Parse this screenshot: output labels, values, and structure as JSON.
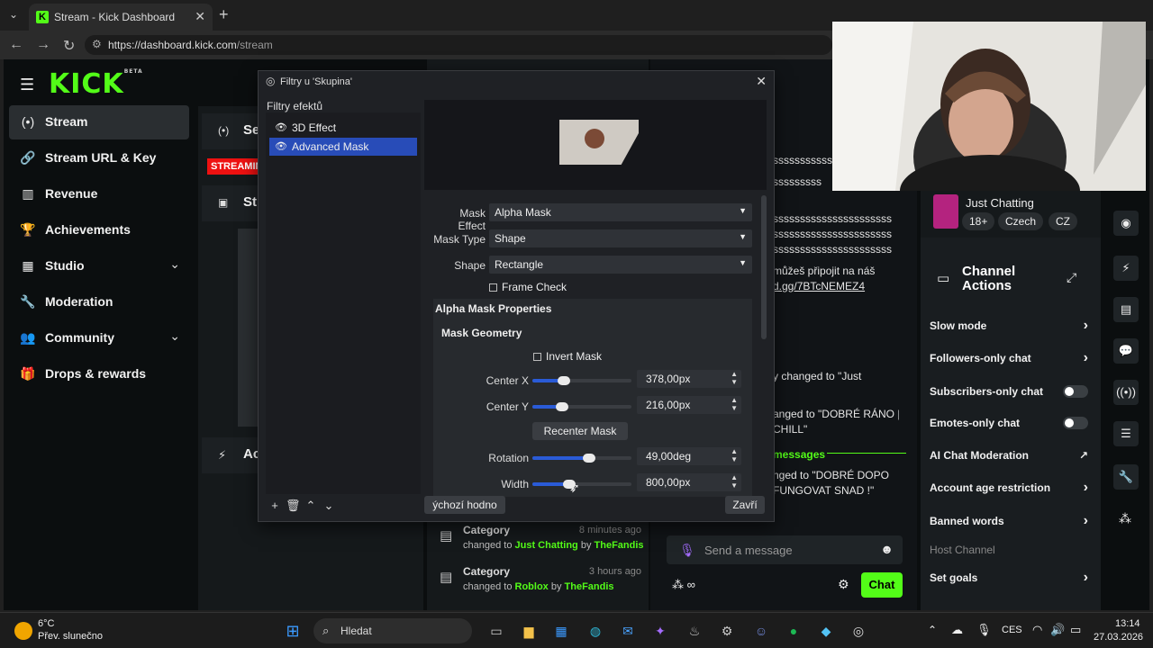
{
  "browser": {
    "tab_title": "Stream - Kick Dashboard",
    "tab_favicon": "K",
    "url_host": "https://dashboard.kick.com",
    "url_path": "/stream"
  },
  "kick": {
    "logo": "KICK",
    "logo_sup": "BETA",
    "nav": [
      {
        "label": "Stream",
        "icon": "broadcast-icon"
      },
      {
        "label": "Stream URL & Key",
        "icon": "link-icon"
      },
      {
        "label": "Revenue",
        "icon": "chart-icon"
      },
      {
        "label": "Achievements",
        "icon": "trophy-icon"
      },
      {
        "label": "Studio",
        "icon": "film-icon"
      },
      {
        "label": "Moderation",
        "icon": "wrench-icon"
      },
      {
        "label": "Community",
        "icon": "people-icon"
      },
      {
        "label": "Drops & rewards",
        "icon": "gift-icon"
      }
    ],
    "session_label": "Se",
    "streaming_badge": "STREAMIN",
    "stream_card_label": "Str",
    "activity_label": "Ac",
    "accent": "#53fc18"
  },
  "activity": [
    {
      "title": "Category",
      "time": "8 minutes ago",
      "prefix": "changed to",
      "value": "Just Chatting",
      "by": "by",
      "user": "TheFandis"
    },
    {
      "title": "Category",
      "time": "3 hours ago",
      "prefix": "changed to",
      "value": "Roblox",
      "by": "by",
      "user": "TheFandis"
    }
  ],
  "chat": {
    "lines": [
      "sssssssssss",
      "sssssssss",
      "ssssssssssssssssssssss",
      "ssssssssssssssssssssss",
      "ssssssssssssssssssssss"
    ],
    "msg1a": "můžeš připojit na náš",
    "msg1b": "d.gg/7BTcNEMEZ4",
    "msg2": "y changed to \"Just",
    "msg3a": "anged to \"DOBRÉ RÁNO |",
    "msg3b": "CHILL\"",
    "divider": "messages",
    "msg4a": "nged to \"DOBRÉ DOPO",
    "msg4b": "FUNGOVAT SNAD !\"",
    "input_placeholder": "Send a message",
    "send_button": "Chat"
  },
  "stream_info": {
    "category": "Just Chatting",
    "tags": [
      "18+",
      "Czech",
      "CZ"
    ]
  },
  "channel_actions": {
    "title_line1": "Channel",
    "title_line2": "Actions",
    "items": [
      {
        "label": "Slow mode",
        "control": "arrow"
      },
      {
        "label": "Followers-only chat",
        "control": "arrow"
      },
      {
        "label": "Subscribers-only chat",
        "control": "toggle"
      },
      {
        "label": "Emotes-only chat",
        "control": "toggle"
      },
      {
        "label": "AI Chat Moderation",
        "control": "external"
      },
      {
        "label": "Account age restriction",
        "control": "arrow"
      },
      {
        "label": "Banned words",
        "control": "arrow"
      },
      {
        "label": "Host Channel",
        "control": "none"
      },
      {
        "label": "Set goals",
        "control": "arrow"
      }
    ]
  },
  "obs": {
    "window_title": "Filtry u 'Skupina'",
    "filters_heading": "Filtry efektů",
    "filters": [
      {
        "name": "3D Effect",
        "selected": false
      },
      {
        "name": "Advanced Mask",
        "selected": true
      }
    ],
    "mask_effect_label": "Mask Effect",
    "mask_effect_value": "Alpha Mask",
    "mask_type_label": "Mask Type",
    "mask_type_value": "Shape",
    "shape_label": "Shape",
    "shape_value": "Rectangle",
    "frame_check": "Frame Check",
    "alpha_props": "Alpha Mask Properties",
    "geometry": "Mask Geometry",
    "invert_mask": "Invert Mask",
    "sliders": [
      {
        "label": "Center X",
        "value": "378,00px",
        "level": 0.32
      },
      {
        "label": "Center Y",
        "value": "216,00px",
        "level": 0.3
      },
      {
        "label": "Rotation",
        "value": "49,00deg",
        "level": 0.57
      },
      {
        "label": "Width",
        "value": "800,00px",
        "level": 0.37
      }
    ],
    "recenter": "Recenter Mask",
    "defaults_button": "ýchozí hodno",
    "close_button": "Zavří"
  },
  "taskbar": {
    "weather_temp": "6°C",
    "weather_desc": "Přev. slunečno",
    "search": "Hledat",
    "lang": "CES",
    "time": "13:14",
    "date": "27.03.2026"
  }
}
